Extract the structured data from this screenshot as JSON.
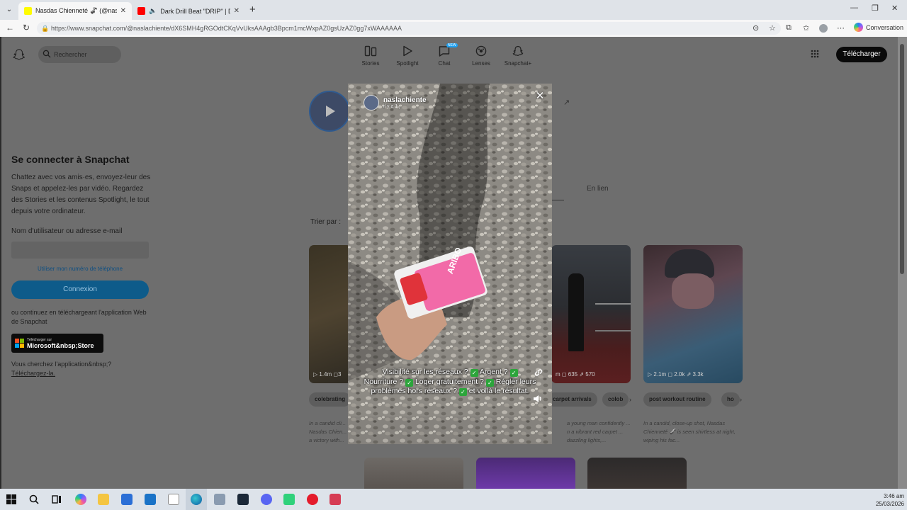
{
  "browser": {
    "tabs": [
      {
        "title": "Nasdas Chienneté 🦨 (@nasla",
        "close": "✕",
        "active": true
      },
      {
        "title": "Dark Drill Beat \"DRIP\" | Drill R",
        "close": "✕",
        "active": false
      }
    ],
    "new_tab": "+",
    "url": "https://www.snapchat.com/@naslachiente/dX6SMH4gRGOdtCKqVvUksAAAgb3Bpcm1mcWxpAZ0gsUzAZ0gg7xWAAAAAA",
    "conversation_label": "Conversation"
  },
  "header": {
    "search_placeholder": "Rechercher",
    "nav": [
      {
        "label": "Stories",
        "icon": "stories-icon"
      },
      {
        "label": "Spotlight",
        "icon": "spotlight-icon"
      },
      {
        "label": "Chat",
        "icon": "chat-icon",
        "badge": "NEW"
      },
      {
        "label": "Lenses",
        "icon": "lenses-icon"
      },
      {
        "label": "Snapchat+",
        "icon": "snapchat-plus-icon"
      }
    ],
    "download_label": "Télécharger"
  },
  "login": {
    "title": "Se connecter à Snapchat",
    "description": "Chattez avec vos amis·es, envoyez-leur des Snaps et appelez-les par vidéo. Regardez des Stories et les contenus Spotlight, le tout depuis votre ordinateur.",
    "username_label": "Nom d'utilisateur ou adresse e-mail",
    "phone_link": "Utiliser mon numéro de téléphone",
    "submit_label": "Connexion",
    "or_text": "ou continuez en téléchargeant l'application Web de Snapchat",
    "store_small": "Télécharger sur",
    "store_big": "Microsoft&nbsp;Store",
    "looking_text": "Vous cherchez l'application&nbsp;?",
    "looking_link": "Téléchargez-la."
  },
  "profile": {
    "tab_link": "En lien",
    "sort_label": "Trier par :"
  },
  "cards": [
    {
      "stats": "▷ 1.4m  ◻3",
      "chips": [
        "colebrating"
      ],
      "caption": "In a candid cli... Nasdas Chien... a victory with..."
    },
    {
      "stats": "m  ◻ 635  ⇗ 570",
      "chips": [
        "carpet arrivals",
        "colob"
      ],
      "caption": "a young man confidently ... n a vibrant red carpet ... dazzling lights,..."
    },
    {
      "stats": "▷ 2.1m  ◻ 2.0k  ⇗ 3.3k",
      "chips": [
        "post workout routine",
        "ho"
      ],
      "caption": "In a candid, close-up shot, Nasdas Chienneté 🦨 is seen shirtless at night, wiping his fac..."
    }
  ],
  "modal": {
    "username": "naslachiente",
    "subtitle": "il y a 1 j",
    "close": "✕",
    "overlay_line1": "Visibilité sur les réseaux ?",
    "overlay_line1b": "Argent ?",
    "overlay_line2": "Nourriture ?",
    "overlay_line2b": "Loger gratuitement ?",
    "overlay_line2c": "Régler leurs",
    "overlay_line3": "problèmes hors réseaux ?",
    "overlay_line3b": "et voilà le résultat.",
    "check": "✓"
  },
  "taskbar": {
    "time": "3:46 am",
    "date": "25/03/2026"
  },
  "colors": {
    "snap_blue": "#0e5b8a",
    "download_btn": "#0a0a0a",
    "check_green": "#2ca53b"
  }
}
